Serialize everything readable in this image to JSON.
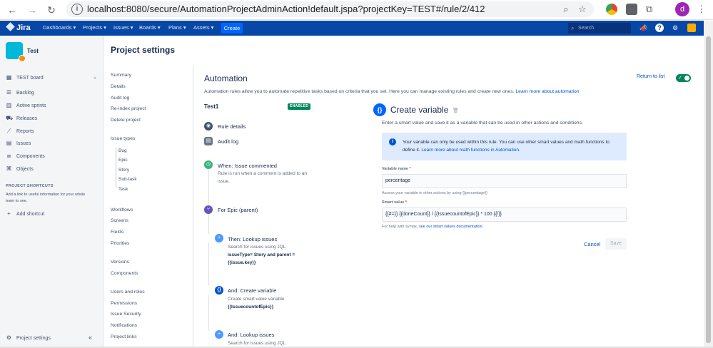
{
  "browser": {
    "url": "localhost:8080/secure/AutomationProjectAdminAction!default.jspa?projectKey=TEST#/rule/2/412",
    "profile_initial": "d"
  },
  "topbar": {
    "product": "Jira",
    "nav": [
      "Dashboards ▾",
      "Projects ▾",
      "Issues ▾",
      "Boards ▾",
      "Plans ▾",
      "Assets ▾"
    ],
    "create_label": "Create",
    "search_placeholder": "Search"
  },
  "sidebar": {
    "project_name": "Test",
    "board": "TEST board",
    "items": [
      "Backlog",
      "Active sprints",
      "Releases",
      "Reports",
      "Issues",
      "Components",
      "Objects"
    ],
    "shortcuts_heading": "PROJECT SHORTCUTS",
    "shortcuts_note": "Add a link to useful information for your whole team to see.",
    "add_shortcut": "Add shortcut",
    "project_settings": "Project settings"
  },
  "settings_nav": {
    "title": "Project settings",
    "group1": [
      "Summary",
      "Details",
      "Audit log",
      "Re-index project",
      "Delete project"
    ],
    "issue_types_label": "Issue types",
    "issue_types": [
      "Bug",
      "Epic",
      "Story",
      "Sub-task",
      "Task"
    ],
    "group2": [
      "Workflows",
      "Screens",
      "Fields",
      "Priorities"
    ],
    "group3": [
      "Versions",
      "Components"
    ],
    "group4": [
      "Users and roles",
      "Permissions",
      "Issue Security",
      "Notifications",
      "Project links"
    ]
  },
  "automation": {
    "heading": "Automation",
    "description": "Automation rules allow you to automate repetitive tasks based on criteria that you set. Here you can manage existing rules and create new ones.",
    "learn_more": "Learn more about automation",
    "return_link": "Return to list",
    "toggle_on": true
  },
  "rule": {
    "name": "Test1",
    "status": "ENABLED",
    "rule_details": "Rule details",
    "audit_log": "Audit log",
    "components": [
      {
        "title": "When: Issue commented",
        "desc": "Rule is run when a comment is added to an issue."
      },
      {
        "title": "For Epic (parent)"
      },
      {
        "title": "Then: Lookup issues",
        "desc": "Search for issues using JQL",
        "code": "issueType= Story and parent = {{issue.key}}"
      },
      {
        "title": "And: Create variable",
        "desc": "Create smart value variable",
        "code": "{{IssuecountofEpic}}"
      },
      {
        "title": "And: Lookup issues",
        "desc": "Search for issues using JQL"
      }
    ]
  },
  "editor": {
    "title": "Create variable",
    "description": "Enter a smart value and save it as a variable that can be used in other actions and conditions.",
    "info": "Your variable can only be used within this rule. You can use other smart values and math functions to define it.",
    "info_link": "Learn more about math functions in Automation.",
    "variable_name_label": "Variable name",
    "variable_name_value": "percentage",
    "variable_help": "Access your variable in other actions by using {{percentage}}",
    "smart_value_label": "Smart value",
    "smart_value_value": "{{#=}} {{doneCount}} / {{IssuecountofEpic}} * 100 {{/}}",
    "smart_help_prefix": "For help with syntax,",
    "smart_help_link": "see our smart values documentation.",
    "cancel_label": "Cancel",
    "save_label": "Save"
  }
}
